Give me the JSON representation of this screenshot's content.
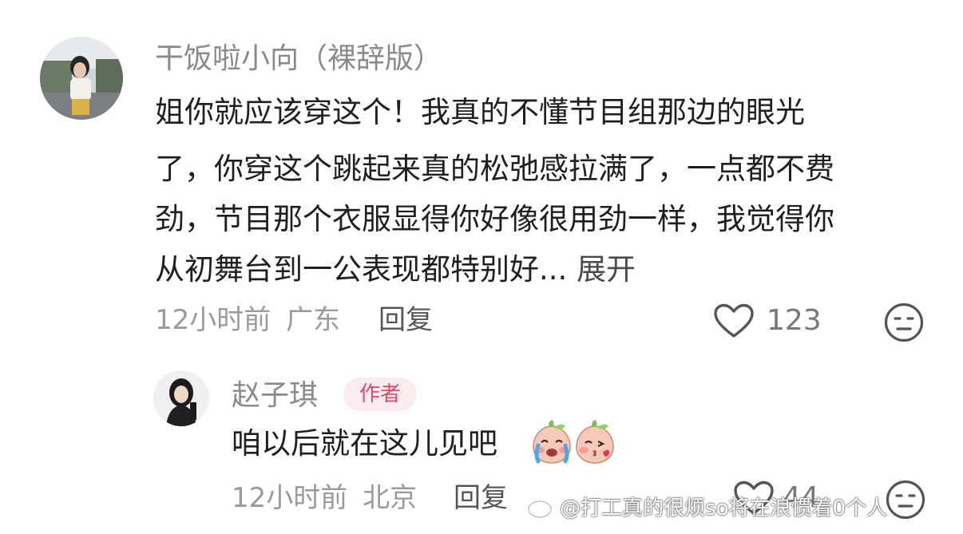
{
  "comment": {
    "username": "干饭啦小向（裸辞版）",
    "lines": [
      "姐你就应该穿这个！我真的不懂节目组那边的眼光",
      "了，你穿这个跳起来真的松弛感拉满了，一点都不费",
      "劲，节目那个衣服显得你好像很用劲一样，我觉得你",
      "从初舞台到一公表现都特别好..."
    ],
    "expand_label": "展开",
    "time": "12小时前",
    "location": "广东",
    "reply_label": "回复",
    "like_count": "123"
  },
  "reply": {
    "username": "赵子琪",
    "badge": "作者",
    "text": "咱以后就在这儿见吧",
    "time": "12小时前",
    "location": "北京",
    "reply_label": "回复",
    "like_count": "44"
  },
  "watermark": "@打工真的很烦so将在浪惯着0个人",
  "icons": {
    "like": "heart-outline-icon",
    "dislike": "meh-face-icon",
    "emoji1": "crying-peach-emoji",
    "emoji2": "kiss-peach-emoji",
    "watermark_logo": "weibo-logo-icon"
  },
  "colors": {
    "badge_bg": "#fdecef",
    "badge_text": "#e04a6a"
  }
}
